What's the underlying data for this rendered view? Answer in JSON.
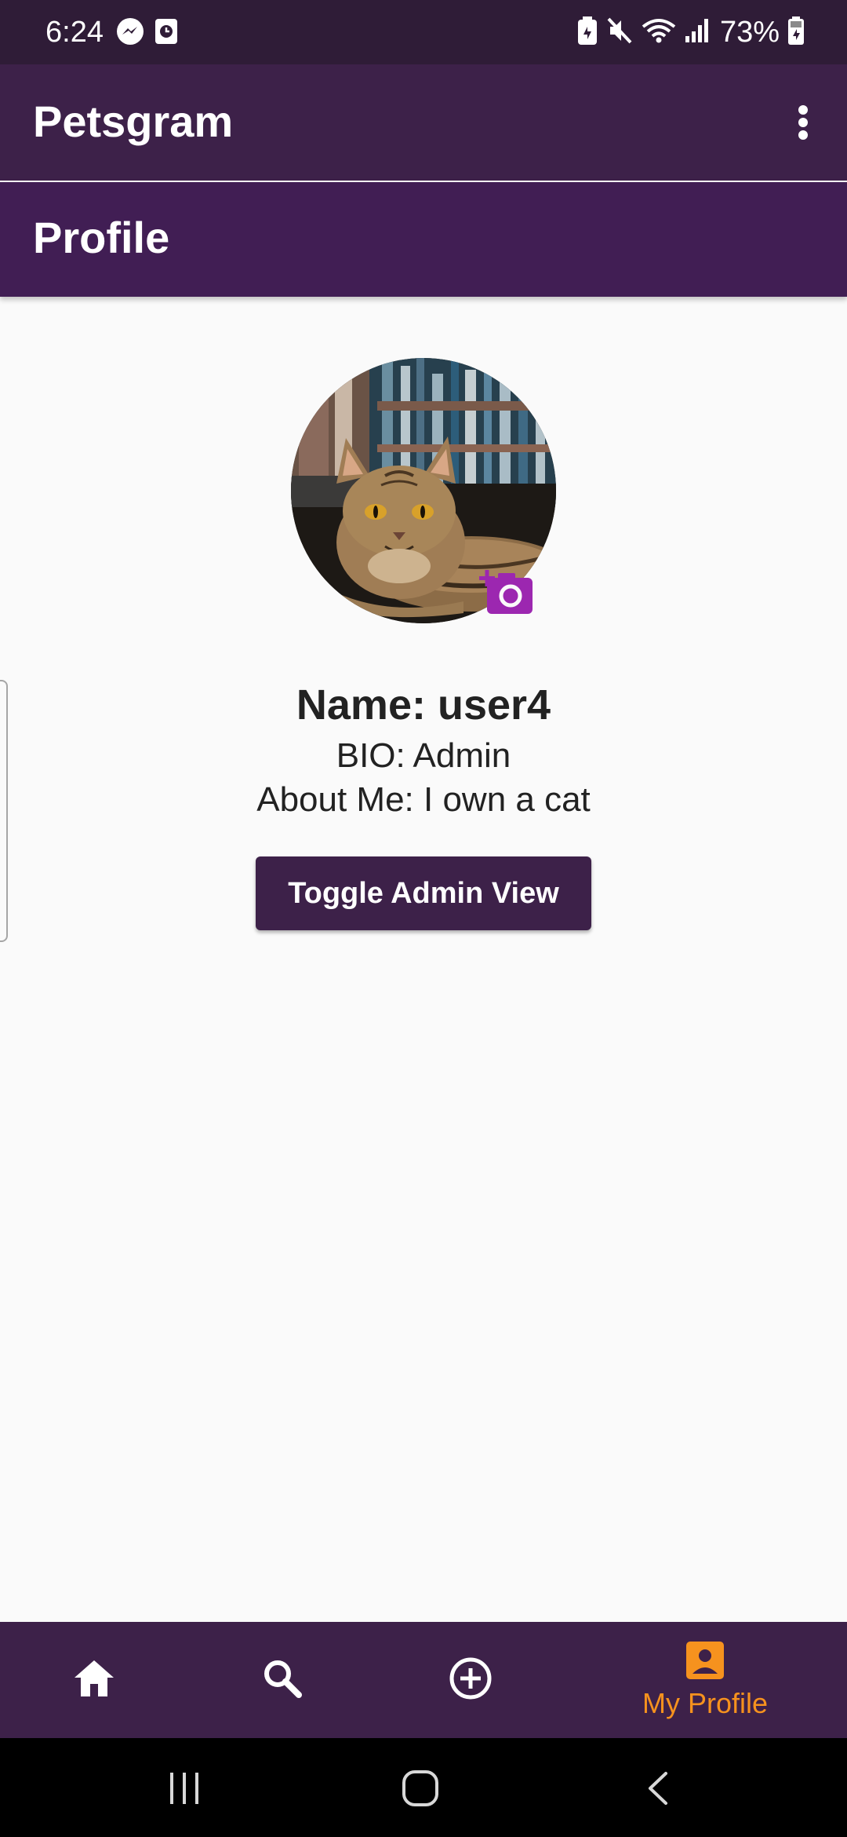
{
  "status_bar": {
    "time": "6:24",
    "battery": "73%",
    "left_icons": [
      "messenger-icon",
      "screen-time-icon"
    ],
    "right_icons": [
      "battery-saver-icon",
      "mute-icon",
      "wifi-icon",
      "signal-icon",
      "battery-icon"
    ]
  },
  "app_bar": {
    "title": "Petsgram",
    "menu_icon": "more-vert-icon"
  },
  "page": {
    "title": "Profile"
  },
  "profile": {
    "avatar_subject": "tabby cat",
    "name": "Name: user4",
    "bio": "BIO: Admin",
    "about": "About Me: I own a cat",
    "toggle_button": "Toggle Admin View"
  },
  "bottom_nav": {
    "items": [
      {
        "icon": "home-icon",
        "label": "",
        "active": false
      },
      {
        "icon": "search-icon",
        "label": "",
        "active": false
      },
      {
        "icon": "add-circle-icon",
        "label": "",
        "active": false
      },
      {
        "icon": "account-box-icon",
        "label": "My Profile",
        "active": true
      }
    ]
  },
  "colors": {
    "status_bar": "#2f1c37",
    "app_bar": "#3d2149",
    "page_header": "#411e54",
    "accent": "#f6921e",
    "camera": "#9c27b0",
    "background": "#fafafa"
  }
}
